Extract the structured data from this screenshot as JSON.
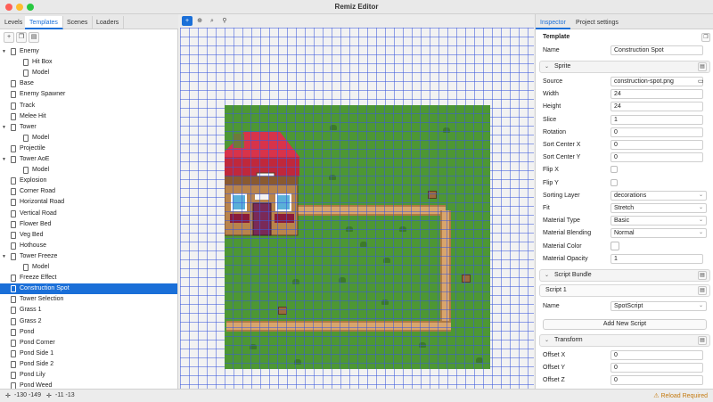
{
  "window": {
    "title": "Remiz Editor"
  },
  "left_tabs": [
    "Levels",
    "Templates",
    "Scenes",
    "Loaders"
  ],
  "left_active_tab": 1,
  "left_toolbar": [
    "new-file-icon",
    "duplicate-icon",
    "trash-icon"
  ],
  "tree": [
    {
      "label": "Enemy",
      "level": 0,
      "caret": true
    },
    {
      "label": "Hit Box",
      "level": 1
    },
    {
      "label": "Model",
      "level": 1
    },
    {
      "label": "Base",
      "level": 0
    },
    {
      "label": "Enemy Spawner",
      "level": 0
    },
    {
      "label": "Track",
      "level": 0
    },
    {
      "label": "Melee Hit",
      "level": 0
    },
    {
      "label": "Tower",
      "level": 0,
      "caret": true
    },
    {
      "label": "Model",
      "level": 1
    },
    {
      "label": "Projectile",
      "level": 0
    },
    {
      "label": "Tower AoE",
      "level": 0,
      "caret": true
    },
    {
      "label": "Model",
      "level": 1
    },
    {
      "label": "Explosion",
      "level": 0
    },
    {
      "label": "Corner Road",
      "level": 0
    },
    {
      "label": "Horizontal Road",
      "level": 0
    },
    {
      "label": "Vertical Road",
      "level": 0
    },
    {
      "label": "Flower Bed",
      "level": 0
    },
    {
      "label": "Veg Bed",
      "level": 0
    },
    {
      "label": "Hothouse",
      "level": 0
    },
    {
      "label": "Tower Freeze",
      "level": 0,
      "caret": true
    },
    {
      "label": "Model",
      "level": 1
    },
    {
      "label": "Freeze Effect",
      "level": 0
    },
    {
      "label": "Construction Spot",
      "level": 0,
      "selected": true
    },
    {
      "label": "Tower Selection",
      "level": 0
    },
    {
      "label": "Grass 1",
      "level": 0
    },
    {
      "label": "Grass 2",
      "level": 0
    },
    {
      "label": "Pond",
      "level": 0
    },
    {
      "label": "Pond Corner",
      "level": 0
    },
    {
      "label": "Pond Side 1",
      "level": 0
    },
    {
      "label": "Pond Side 2",
      "level": 0
    },
    {
      "label": "Pond Lily",
      "level": 0
    },
    {
      "label": "Pond Weed",
      "level": 0
    }
  ],
  "center_tools": [
    "move-icon",
    "crosshair-icon",
    "zoom-icon",
    "user-icon"
  ],
  "inspector": {
    "tabs": [
      "Inspector",
      "Project settings"
    ],
    "active_tab": 0,
    "template_heading": "Template",
    "name_label": "Name",
    "name_value": "Construction Spot",
    "sprite": {
      "title": "Sprite",
      "fields": [
        {
          "label": "Source",
          "value": "construction-spot.png",
          "kind": "file"
        },
        {
          "label": "Width",
          "value": "24",
          "kind": "text"
        },
        {
          "label": "Height",
          "value": "24",
          "kind": "text"
        },
        {
          "label": "Slice",
          "value": "1",
          "kind": "text"
        },
        {
          "label": "Rotation",
          "value": "0",
          "kind": "text"
        },
        {
          "label": "Sort Center X",
          "value": "0",
          "kind": "text"
        },
        {
          "label": "Sort Center Y",
          "value": "0",
          "kind": "text"
        },
        {
          "label": "Flip X",
          "value": "",
          "kind": "check"
        },
        {
          "label": "Flip Y",
          "value": "",
          "kind": "check"
        },
        {
          "label": "Sorting Layer",
          "value": "decorations",
          "kind": "select"
        },
        {
          "label": "Fit",
          "value": "Stretch",
          "kind": "select"
        },
        {
          "label": "Material Type",
          "value": "Basic",
          "kind": "select"
        },
        {
          "label": "Material Blending",
          "value": "Normal",
          "kind": "select"
        },
        {
          "label": "Material Color",
          "value": "",
          "kind": "color"
        },
        {
          "label": "Material Opacity",
          "value": "1",
          "kind": "text"
        }
      ]
    },
    "script_bundle": {
      "title": "Script Bundle",
      "script_title": "Script 1",
      "name_label": "Name",
      "name_value": "SpotScript",
      "add_button": "Add New Script"
    },
    "transform": {
      "title": "Transform",
      "fields": [
        {
          "label": "Offset X",
          "value": "0"
        },
        {
          "label": "Offset Y",
          "value": "0"
        },
        {
          "label": "Offset Z",
          "value": "0"
        }
      ]
    }
  },
  "status": {
    "cursor": "-130 -149",
    "offset": "-11 -13",
    "warning": "Reload Required"
  },
  "colors": {
    "accent": "#1a6fd8",
    "grass": "#4d9734",
    "warning": "#c47a10"
  }
}
